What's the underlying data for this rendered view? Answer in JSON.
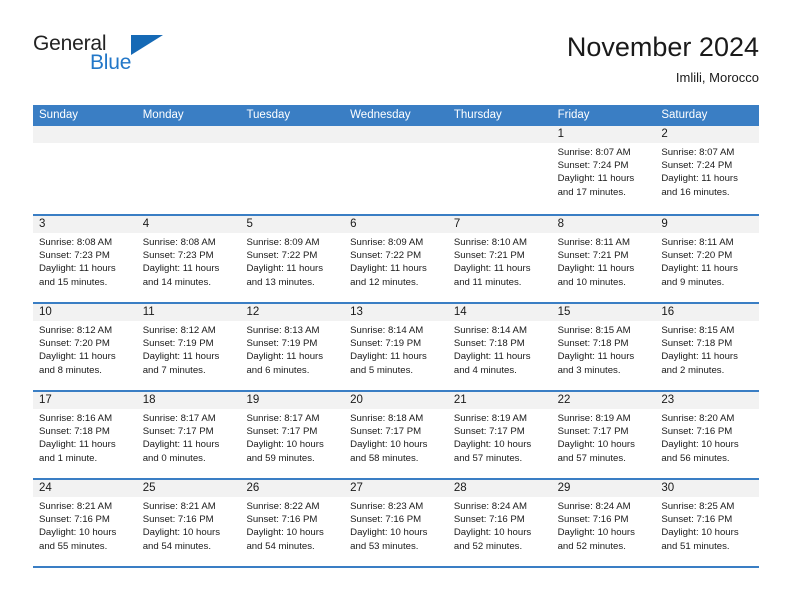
{
  "brand": {
    "name_part1": "General",
    "name_part2": "Blue",
    "triangle_color": "#1569b5",
    "blue_text_color": "#2277c8"
  },
  "header": {
    "title": "November 2024",
    "subtitle": "Imlili, Morocco"
  },
  "theme": {
    "header_bar_color": "#3a7ec4",
    "day_band_color": "#f2f2f2",
    "text_color": "#1a1a1a"
  },
  "weekdays": [
    "Sunday",
    "Monday",
    "Tuesday",
    "Wednesday",
    "Thursday",
    "Friday",
    "Saturday"
  ],
  "weeks": [
    [
      {
        "day": "",
        "sunrise": "",
        "sunset": "",
        "daylight": "",
        "empty": true
      },
      {
        "day": "",
        "sunrise": "",
        "sunset": "",
        "daylight": "",
        "empty": true
      },
      {
        "day": "",
        "sunrise": "",
        "sunset": "",
        "daylight": "",
        "empty": true
      },
      {
        "day": "",
        "sunrise": "",
        "sunset": "",
        "daylight": "",
        "empty": true
      },
      {
        "day": "",
        "sunrise": "",
        "sunset": "",
        "daylight": "",
        "empty": true
      },
      {
        "day": "1",
        "sunrise": "Sunrise: 8:07 AM",
        "sunset": "Sunset: 7:24 PM",
        "daylight": "Daylight: 11 hours and 17 minutes.",
        "empty": false
      },
      {
        "day": "2",
        "sunrise": "Sunrise: 8:07 AM",
        "sunset": "Sunset: 7:24 PM",
        "daylight": "Daylight: 11 hours and 16 minutes.",
        "empty": false
      }
    ],
    [
      {
        "day": "3",
        "sunrise": "Sunrise: 8:08 AM",
        "sunset": "Sunset: 7:23 PM",
        "daylight": "Daylight: 11 hours and 15 minutes.",
        "empty": false
      },
      {
        "day": "4",
        "sunrise": "Sunrise: 8:08 AM",
        "sunset": "Sunset: 7:23 PM",
        "daylight": "Daylight: 11 hours and 14 minutes.",
        "empty": false
      },
      {
        "day": "5",
        "sunrise": "Sunrise: 8:09 AM",
        "sunset": "Sunset: 7:22 PM",
        "daylight": "Daylight: 11 hours and 13 minutes.",
        "empty": false
      },
      {
        "day": "6",
        "sunrise": "Sunrise: 8:09 AM",
        "sunset": "Sunset: 7:22 PM",
        "daylight": "Daylight: 11 hours and 12 minutes.",
        "empty": false
      },
      {
        "day": "7",
        "sunrise": "Sunrise: 8:10 AM",
        "sunset": "Sunset: 7:21 PM",
        "daylight": "Daylight: 11 hours and 11 minutes.",
        "empty": false
      },
      {
        "day": "8",
        "sunrise": "Sunrise: 8:11 AM",
        "sunset": "Sunset: 7:21 PM",
        "daylight": "Daylight: 11 hours and 10 minutes.",
        "empty": false
      },
      {
        "day": "9",
        "sunrise": "Sunrise: 8:11 AM",
        "sunset": "Sunset: 7:20 PM",
        "daylight": "Daylight: 11 hours and 9 minutes.",
        "empty": false
      }
    ],
    [
      {
        "day": "10",
        "sunrise": "Sunrise: 8:12 AM",
        "sunset": "Sunset: 7:20 PM",
        "daylight": "Daylight: 11 hours and 8 minutes.",
        "empty": false
      },
      {
        "day": "11",
        "sunrise": "Sunrise: 8:12 AM",
        "sunset": "Sunset: 7:19 PM",
        "daylight": "Daylight: 11 hours and 7 minutes.",
        "empty": false
      },
      {
        "day": "12",
        "sunrise": "Sunrise: 8:13 AM",
        "sunset": "Sunset: 7:19 PM",
        "daylight": "Daylight: 11 hours and 6 minutes.",
        "empty": false
      },
      {
        "day": "13",
        "sunrise": "Sunrise: 8:14 AM",
        "sunset": "Sunset: 7:19 PM",
        "daylight": "Daylight: 11 hours and 5 minutes.",
        "empty": false
      },
      {
        "day": "14",
        "sunrise": "Sunrise: 8:14 AM",
        "sunset": "Sunset: 7:18 PM",
        "daylight": "Daylight: 11 hours and 4 minutes.",
        "empty": false
      },
      {
        "day": "15",
        "sunrise": "Sunrise: 8:15 AM",
        "sunset": "Sunset: 7:18 PM",
        "daylight": "Daylight: 11 hours and 3 minutes.",
        "empty": false
      },
      {
        "day": "16",
        "sunrise": "Sunrise: 8:15 AM",
        "sunset": "Sunset: 7:18 PM",
        "daylight": "Daylight: 11 hours and 2 minutes.",
        "empty": false
      }
    ],
    [
      {
        "day": "17",
        "sunrise": "Sunrise: 8:16 AM",
        "sunset": "Sunset: 7:18 PM",
        "daylight": "Daylight: 11 hours and 1 minute.",
        "empty": false
      },
      {
        "day": "18",
        "sunrise": "Sunrise: 8:17 AM",
        "sunset": "Sunset: 7:17 PM",
        "daylight": "Daylight: 11 hours and 0 minutes.",
        "empty": false
      },
      {
        "day": "19",
        "sunrise": "Sunrise: 8:17 AM",
        "sunset": "Sunset: 7:17 PM",
        "daylight": "Daylight: 10 hours and 59 minutes.",
        "empty": false
      },
      {
        "day": "20",
        "sunrise": "Sunrise: 8:18 AM",
        "sunset": "Sunset: 7:17 PM",
        "daylight": "Daylight: 10 hours and 58 minutes.",
        "empty": false
      },
      {
        "day": "21",
        "sunrise": "Sunrise: 8:19 AM",
        "sunset": "Sunset: 7:17 PM",
        "daylight": "Daylight: 10 hours and 57 minutes.",
        "empty": false
      },
      {
        "day": "22",
        "sunrise": "Sunrise: 8:19 AM",
        "sunset": "Sunset: 7:17 PM",
        "daylight": "Daylight: 10 hours and 57 minutes.",
        "empty": false
      },
      {
        "day": "23",
        "sunrise": "Sunrise: 8:20 AM",
        "sunset": "Sunset: 7:16 PM",
        "daylight": "Daylight: 10 hours and 56 minutes.",
        "empty": false
      }
    ],
    [
      {
        "day": "24",
        "sunrise": "Sunrise: 8:21 AM",
        "sunset": "Sunset: 7:16 PM",
        "daylight": "Daylight: 10 hours and 55 minutes.",
        "empty": false
      },
      {
        "day": "25",
        "sunrise": "Sunrise: 8:21 AM",
        "sunset": "Sunset: 7:16 PM",
        "daylight": "Daylight: 10 hours and 54 minutes.",
        "empty": false
      },
      {
        "day": "26",
        "sunrise": "Sunrise: 8:22 AM",
        "sunset": "Sunset: 7:16 PM",
        "daylight": "Daylight: 10 hours and 54 minutes.",
        "empty": false
      },
      {
        "day": "27",
        "sunrise": "Sunrise: 8:23 AM",
        "sunset": "Sunset: 7:16 PM",
        "daylight": "Daylight: 10 hours and 53 minutes.",
        "empty": false
      },
      {
        "day": "28",
        "sunrise": "Sunrise: 8:24 AM",
        "sunset": "Sunset: 7:16 PM",
        "daylight": "Daylight: 10 hours and 52 minutes.",
        "empty": false
      },
      {
        "day": "29",
        "sunrise": "Sunrise: 8:24 AM",
        "sunset": "Sunset: 7:16 PM",
        "daylight": "Daylight: 10 hours and 52 minutes.",
        "empty": false
      },
      {
        "day": "30",
        "sunrise": "Sunrise: 8:25 AM",
        "sunset": "Sunset: 7:16 PM",
        "daylight": "Daylight: 10 hours and 51 minutes.",
        "empty": false
      }
    ]
  ]
}
